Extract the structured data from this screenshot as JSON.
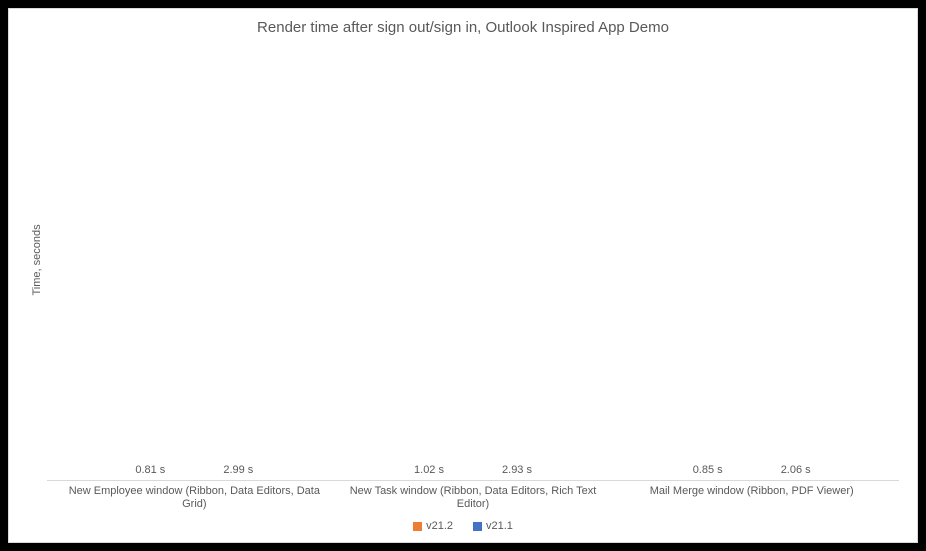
{
  "chart_data": {
    "type": "bar",
    "title": "Render time after sign out/sign in, Outlook Inspired App Demo",
    "ylabel": "Time, seconds",
    "xlabel": "",
    "ylim": [
      0,
      3.1
    ],
    "unit_suffix": " s",
    "categories": [
      "New Employee window (Ribbon, Data Editors, Data Grid)",
      "New Task window (Ribbon, Data Editors, Rich Text Editor)",
      "Mail Merge window (Ribbon, PDF Viewer)"
    ],
    "series": [
      {
        "name": "v21.2",
        "color": "#ED7D31",
        "values": [
          0.81,
          1.02,
          0.85
        ]
      },
      {
        "name": "v21.1",
        "color": "#4472C4",
        "values": [
          2.99,
          2.93,
          2.06
        ]
      }
    ]
  }
}
